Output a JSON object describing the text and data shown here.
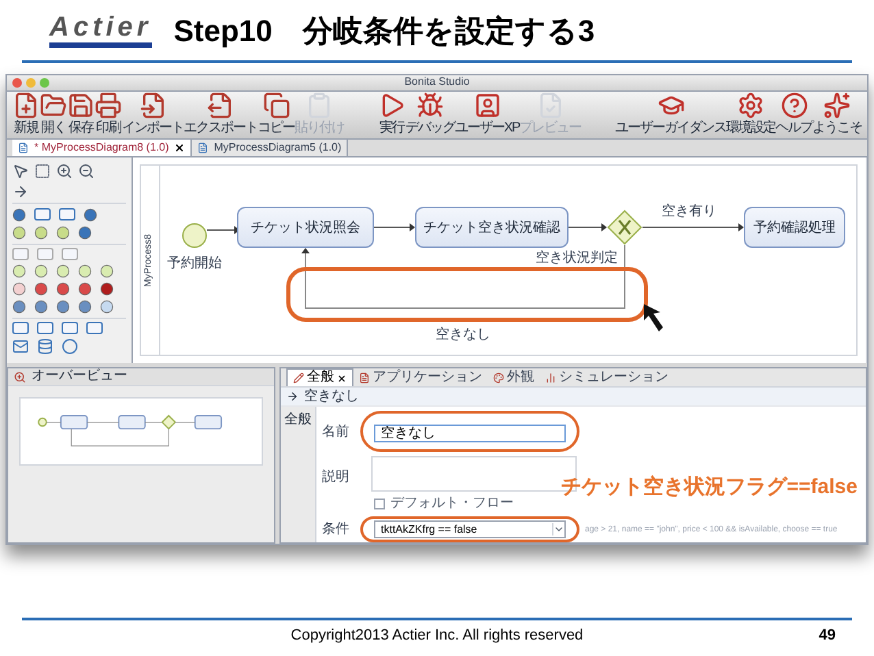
{
  "slide": {
    "logo": "Actier",
    "title": "Step10　分岐条件を設定する3",
    "footer": "Copyright2013 Actier Inc. All rights reserved",
    "page_number": "49"
  },
  "window": {
    "title": "Bonita Studio"
  },
  "toolbar": {
    "groups": [
      [
        {
          "label": "新規",
          "disabled": false
        },
        {
          "label": "開く",
          "disabled": false
        },
        {
          "label": "保存",
          "disabled": false
        },
        {
          "label": "印刷",
          "disabled": false
        },
        {
          "label": "インポート",
          "disabled": false
        },
        {
          "label": "エクスポート",
          "disabled": false
        },
        {
          "label": "コピー",
          "disabled": false
        },
        {
          "label": "貼り付け",
          "disabled": true
        }
      ],
      [
        {
          "label": "実行",
          "disabled": false
        },
        {
          "label": "デバッグ",
          "disabled": false
        },
        {
          "label": "ユーザーXP",
          "disabled": false
        },
        {
          "label": "プレビュー",
          "disabled": true
        }
      ],
      [
        {
          "label": "ユーザーガイダンス",
          "disabled": false
        },
        {
          "label": "環境設定",
          "disabled": false
        },
        {
          "label": "ヘルプ",
          "disabled": false
        },
        {
          "label": "ようこそ",
          "disabled": false
        }
      ]
    ]
  },
  "editor_tabs": [
    {
      "label": "* MyProcessDiagram8 (1.0)",
      "selected": true
    },
    {
      "label": "MyProcessDiagram5 (1.0)",
      "selected": false
    }
  ],
  "diagram": {
    "pool": "MyProcess8",
    "nodes": [
      {
        "kind": "start",
        "label": "予約開始"
      },
      {
        "kind": "task",
        "label": "チケット状況照会"
      },
      {
        "kind": "task",
        "label": "チケット空き状況確認"
      },
      {
        "kind": "gateway",
        "label": "空き状況判定"
      },
      {
        "kind": "task",
        "label": "予約確認処理"
      }
    ],
    "flows": [
      {
        "label": "空き有り"
      },
      {
        "label": "空きなし"
      }
    ]
  },
  "overview": {
    "title": "オーバービュー"
  },
  "properties": {
    "tabs": [
      {
        "label": "全般",
        "selected": true
      },
      {
        "label": "アプリケーション",
        "selected": false
      },
      {
        "label": "外観",
        "selected": false
      },
      {
        "label": "シミュレーション",
        "selected": false
      }
    ],
    "heading": "空きなし",
    "side_tab": "全般",
    "name_label": "名前",
    "name": "空きなし",
    "description_label": "説明",
    "default_flow": {
      "label": "デフォルト・フロー",
      "checked": false
    },
    "condition_label": "条件",
    "condition": "tkttAkZKfrg == false",
    "condition_hint": "age > 21, name == \"john\", price < 100 && isAvailable, choose == true",
    "annotation": "チケット空き状況フラグ==false"
  }
}
